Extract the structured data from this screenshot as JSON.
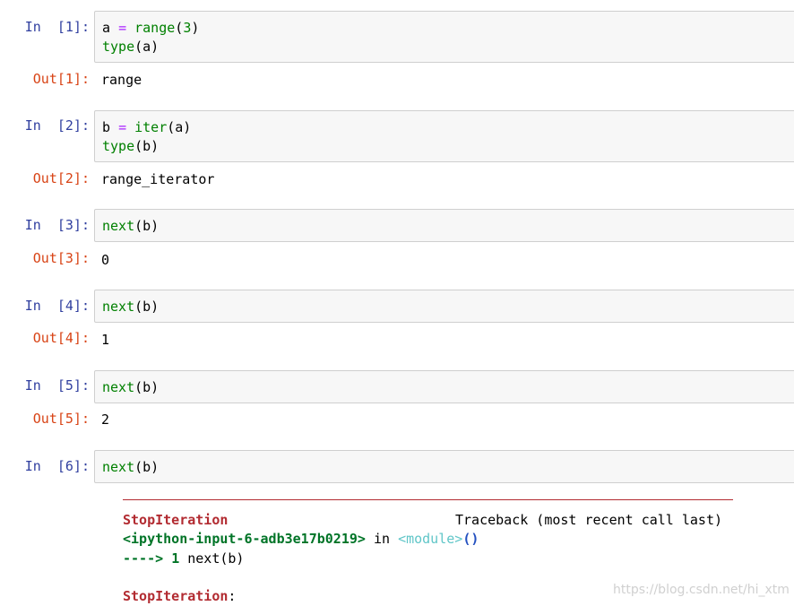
{
  "cells": [
    {
      "in_prompt": "In  [1]:",
      "code_lines": [
        [
          {
            "t": "a",
            "c": "n"
          },
          {
            "t": " ",
            "c": "n"
          },
          {
            "t": "=",
            "c": "o"
          },
          {
            "t": " ",
            "c": "n"
          },
          {
            "t": "range",
            "c": "k"
          },
          {
            "t": "(",
            "c": "p"
          },
          {
            "t": "3",
            "c": "m"
          },
          {
            "t": ")",
            "c": "p"
          }
        ],
        [
          {
            "t": "type",
            "c": "k"
          },
          {
            "t": "(a)",
            "c": "p"
          }
        ]
      ],
      "out_prompt": "Out[1]:",
      "output": "range"
    },
    {
      "in_prompt": "In  [2]:",
      "code_lines": [
        [
          {
            "t": "b",
            "c": "n"
          },
          {
            "t": " ",
            "c": "n"
          },
          {
            "t": "=",
            "c": "o"
          },
          {
            "t": " ",
            "c": "n"
          },
          {
            "t": "iter",
            "c": "k"
          },
          {
            "t": "(a)",
            "c": "p"
          }
        ],
        [
          {
            "t": "type",
            "c": "k"
          },
          {
            "t": "(b)",
            "c": "p"
          }
        ]
      ],
      "out_prompt": "Out[2]:",
      "output": "range_iterator"
    },
    {
      "in_prompt": "In  [3]:",
      "code_lines": [
        [
          {
            "t": "next",
            "c": "k"
          },
          {
            "t": "(b)",
            "c": "p"
          }
        ]
      ],
      "out_prompt": "Out[3]:",
      "output": "0"
    },
    {
      "in_prompt": "In  [4]:",
      "code_lines": [
        [
          {
            "t": "next",
            "c": "k"
          },
          {
            "t": "(b)",
            "c": "p"
          }
        ]
      ],
      "out_prompt": "Out[4]:",
      "output": "1"
    },
    {
      "in_prompt": "In  [5]:",
      "code_lines": [
        [
          {
            "t": "next",
            "c": "k"
          },
          {
            "t": "(b)",
            "c": "p"
          }
        ]
      ],
      "out_prompt": "Out[5]:",
      "output": "2"
    },
    {
      "in_prompt": "In  [6]:",
      "code_lines": [
        [
          {
            "t": "next",
            "c": "k"
          },
          {
            "t": "(b)",
            "c": "p"
          }
        ]
      ],
      "out_prompt": "",
      "output": ""
    }
  ],
  "traceback": {
    "error_name": "StopIteration",
    "traceback_header": "Traceback (most recent call last)",
    "input_ref": "<ipython-input-6-adb3e17b0219>",
    "in_word": " in ",
    "module": "<module>",
    "call_parens": "()",
    "arrow": "---->",
    "line_no": "1",
    "line_code_fn": "next",
    "line_code_args": "(b)",
    "final_error": "StopIteration",
    "final_colon": ":"
  },
  "watermark": "https://blog.csdn.net/hi_xtm"
}
